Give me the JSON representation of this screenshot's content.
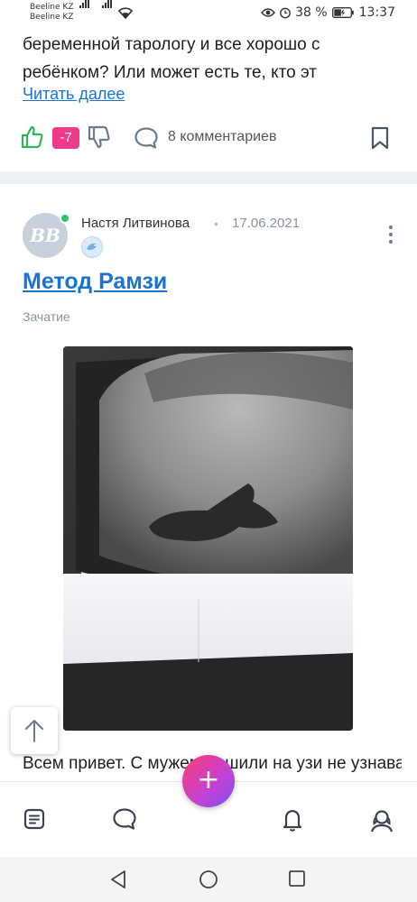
{
  "status_bar": {
    "carrier_1": "Beeline KZ",
    "carrier_2": "Beeline KZ",
    "battery": "38 %",
    "time": "13:37"
  },
  "previous_post": {
    "text": "беременной тарологу и все хорошо с ребёнком? Или может есть те, кто эт",
    "read_more": "Читать далее",
    "score": "-7",
    "comments": "8 комментариев"
  },
  "post": {
    "avatar_initials": "ВВ",
    "author": "Настя Литвинова",
    "separator": "•",
    "date": "17.06.2021",
    "title": "Метод Рамзи",
    "category": "Зачатие",
    "body": "Всем привет. С мужем решили на узи не узнавать кто в животе, а но"
  },
  "colors": {
    "link": "#1a73d1",
    "score_badge": "#ee3a87",
    "online": "#2fc46a"
  },
  "icons": [
    "like-icon",
    "dislike-icon",
    "comment-icon",
    "bookmark-icon",
    "more-icon",
    "arrow-up-icon",
    "feed-icon",
    "chat-icon",
    "bell-icon",
    "profile-icon",
    "plus-icon",
    "back-icon",
    "home-icon",
    "recents-icon"
  ]
}
